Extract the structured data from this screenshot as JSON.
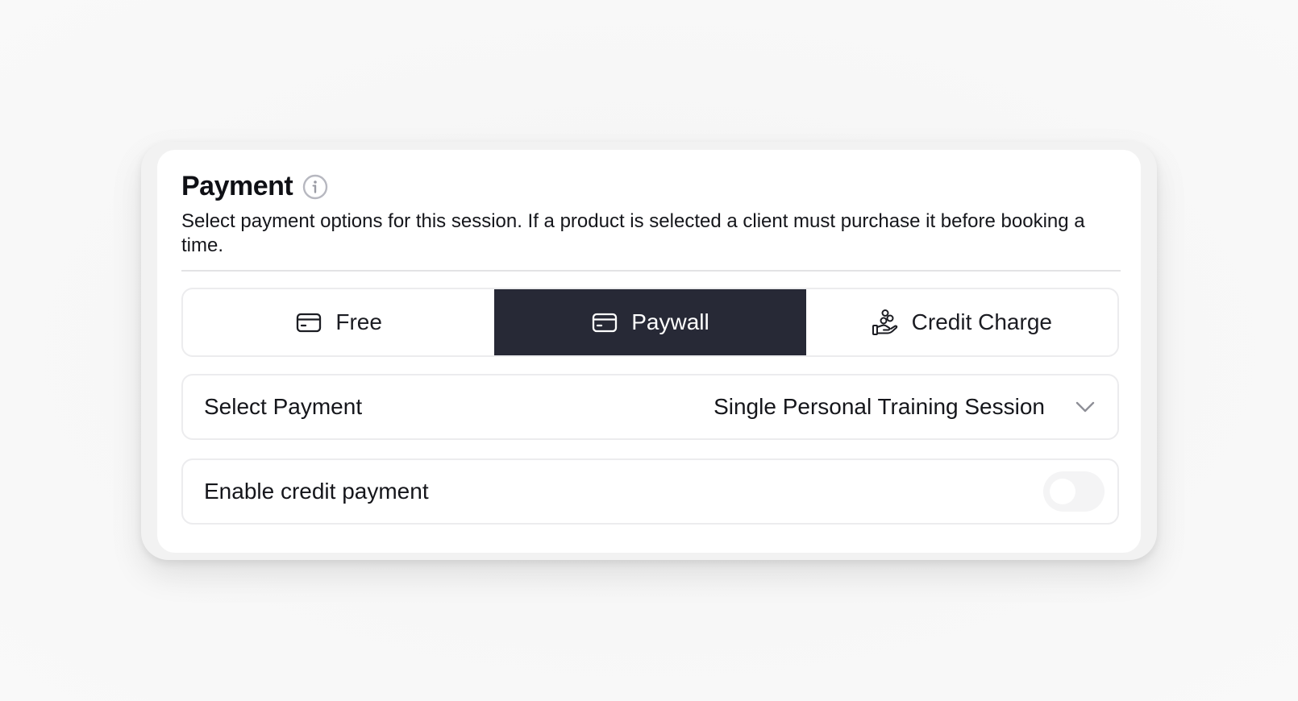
{
  "payment": {
    "title": "Payment",
    "description": "Select payment options for this session. If a product is selected a client must purchase it before booking a time.",
    "icons": {
      "info": "info-icon",
      "free": "credit-card-icon",
      "paywall": "credit-card-icon",
      "credit_charge": "hand-coins-icon",
      "select_chevron": "chevron-down-icon"
    },
    "options": [
      {
        "label": "Free",
        "selected": false
      },
      {
        "label": "Paywall",
        "selected": true
      },
      {
        "label": "Credit Charge",
        "selected": false
      }
    ],
    "select_payment": {
      "label": "Select Payment",
      "value": "Single Personal Training Session"
    },
    "credit_payment": {
      "label": "Enable credit payment",
      "enabled": false
    },
    "colors": {
      "active_segment": "#272936",
      "active_text": "#ffffff",
      "border": "#ececee"
    }
  }
}
